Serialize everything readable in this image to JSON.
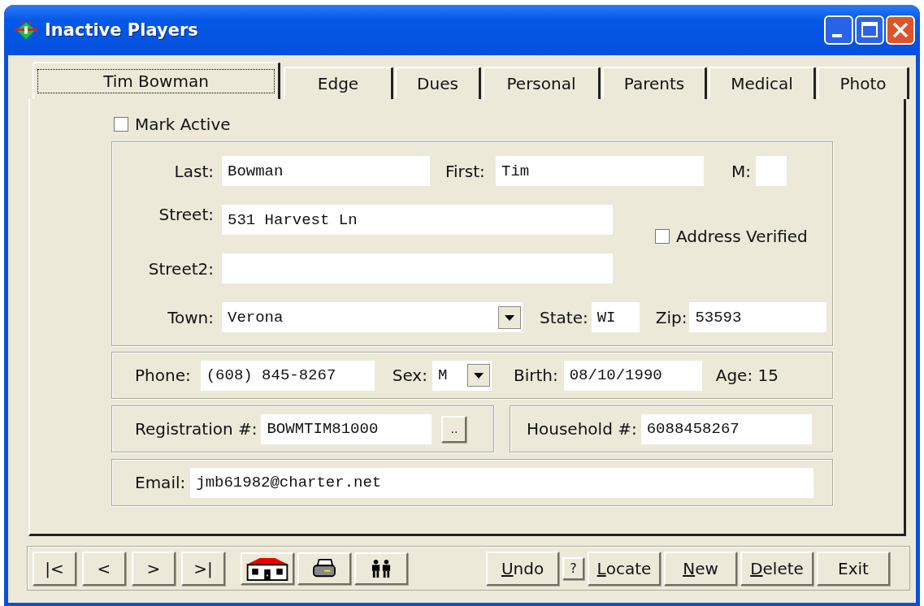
{
  "window": {
    "title": "Inactive Players"
  },
  "tabs": [
    {
      "label": "Tim Bowman",
      "selected": true
    },
    {
      "label": "Edge",
      "selected": false
    },
    {
      "label": "Dues",
      "selected": false
    },
    {
      "label": "Personal",
      "selected": false
    },
    {
      "label": "Parents",
      "selected": false
    },
    {
      "label": "Medical",
      "selected": false
    },
    {
      "label": "Photo",
      "selected": false
    }
  ],
  "mark_active": {
    "label": "Mark Active",
    "checked": false
  },
  "address": {
    "last": {
      "label": "Last:",
      "value": "Bowman"
    },
    "first": {
      "label": "First:",
      "value": "Tim"
    },
    "middle": {
      "label": "M:"
    },
    "street": {
      "label": "Street:",
      "value": "531 Harvest Ln"
    },
    "street2": {
      "label": "Street2:"
    },
    "address_verified": {
      "label": "Address Verified",
      "checked": false
    },
    "town": {
      "label": "Town:",
      "value": "Verona"
    },
    "state": {
      "label": "State:",
      "value": "WI"
    },
    "zip": {
      "label": "Zip:",
      "value": "53593"
    }
  },
  "details": {
    "phone": {
      "label": "Phone:",
      "value": "(608) 845-8267"
    },
    "sex": {
      "label": "Sex:",
      "value": "M"
    },
    "birth": {
      "label": "Birth:",
      "value": "08/10/1990"
    },
    "age": "Age: 15"
  },
  "registration": {
    "label": "Registration #:",
    "value": "BOWMTIM81000",
    "button": ".."
  },
  "household": {
    "label": "Household #:",
    "value": "6088458267"
  },
  "email": {
    "label": "Email:",
    "value": "jmb61982@charter.net"
  },
  "nav_buttons": [
    "|<",
    "<",
    ">",
    ">|"
  ],
  "actions": [
    {
      "kind": "button",
      "accel": "U",
      "rest": "ndo"
    },
    {
      "kind": "small",
      "rest": "?"
    },
    {
      "kind": "button",
      "accel": "L",
      "rest": "ocate"
    },
    {
      "kind": "button",
      "accel": "N",
      "rest": "ew"
    },
    {
      "kind": "button",
      "accel": "D",
      "rest": "elete"
    },
    {
      "kind": "button",
      "rest": "Exit"
    }
  ]
}
